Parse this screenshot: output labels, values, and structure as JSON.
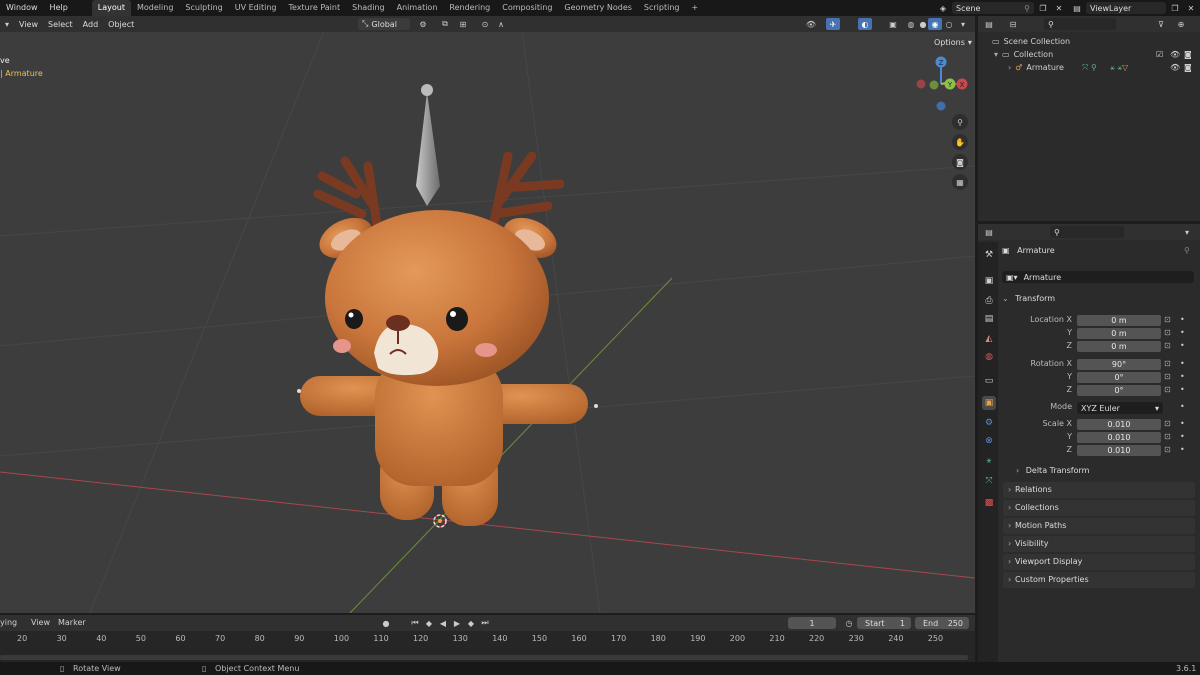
{
  "topbar": {
    "menus": [
      "Window",
      "Help"
    ],
    "workspaces": [
      "Layout",
      "Modeling",
      "Sculpting",
      "UV Editing",
      "Texture Paint",
      "Shading",
      "Animation",
      "Rendering",
      "Compositing",
      "Geometry Nodes",
      "Scripting"
    ],
    "active_workspace": "Layout",
    "add_tab": "+",
    "scene": "Scene",
    "view_layer": "ViewLayer"
  },
  "viewport": {
    "menus": [
      "View",
      "Select",
      "Add",
      "Object"
    ],
    "orientation": "Global",
    "options_label": "Options",
    "mode_text": "ve",
    "active_object": "| Armature",
    "gizmo_axes": {
      "x": "X",
      "y": "Y",
      "z": "Z"
    }
  },
  "outliner": {
    "scene_collection": "Scene Collection",
    "collection": "Collection",
    "armature": "Armature"
  },
  "properties": {
    "object_name": "Armature",
    "data_name": "Armature",
    "transform": "Transform",
    "location_label": "Location X",
    "y": "Y",
    "z": "Z",
    "location": [
      "0 m",
      "0 m",
      "0 m"
    ],
    "rotation_label": "Rotation X",
    "rotation": [
      "90°",
      "0°",
      "0°"
    ],
    "mode_label": "Mode",
    "mode_value": "XYZ Euler",
    "scale_label": "Scale X",
    "scale": [
      "0.010",
      "0.010",
      "0.010"
    ],
    "delta_transform": "Delta Transform",
    "panels": [
      "Relations",
      "Collections",
      "Motion Paths",
      "Visibility",
      "Viewport Display",
      "Custom Properties"
    ]
  },
  "timeline": {
    "menus": [
      "ying",
      "View",
      "Marker"
    ],
    "current_frame": "1",
    "start_label": "Start",
    "start": "1",
    "end_label": "End",
    "end": "250",
    "ticks": [
      "20",
      "30",
      "40",
      "50",
      "60",
      "70",
      "80",
      "90",
      "100",
      "110",
      "120",
      "130",
      "140",
      "150",
      "160",
      "170",
      "180",
      "190",
      "200",
      "210",
      "220",
      "230",
      "240",
      "250"
    ]
  },
  "statusbar": {
    "rotate_view": "Rotate View",
    "context_menu": "Object Context Menu",
    "version": "3.6.1"
  },
  "colors": {
    "viewport_bg": "#3d3d3d",
    "accent_blue": "#4772b3",
    "active_yellow": "#e8c35a",
    "x_axis": "#c8494f",
    "y_axis": "#8ac348",
    "z_axis": "#4b8bd4"
  }
}
